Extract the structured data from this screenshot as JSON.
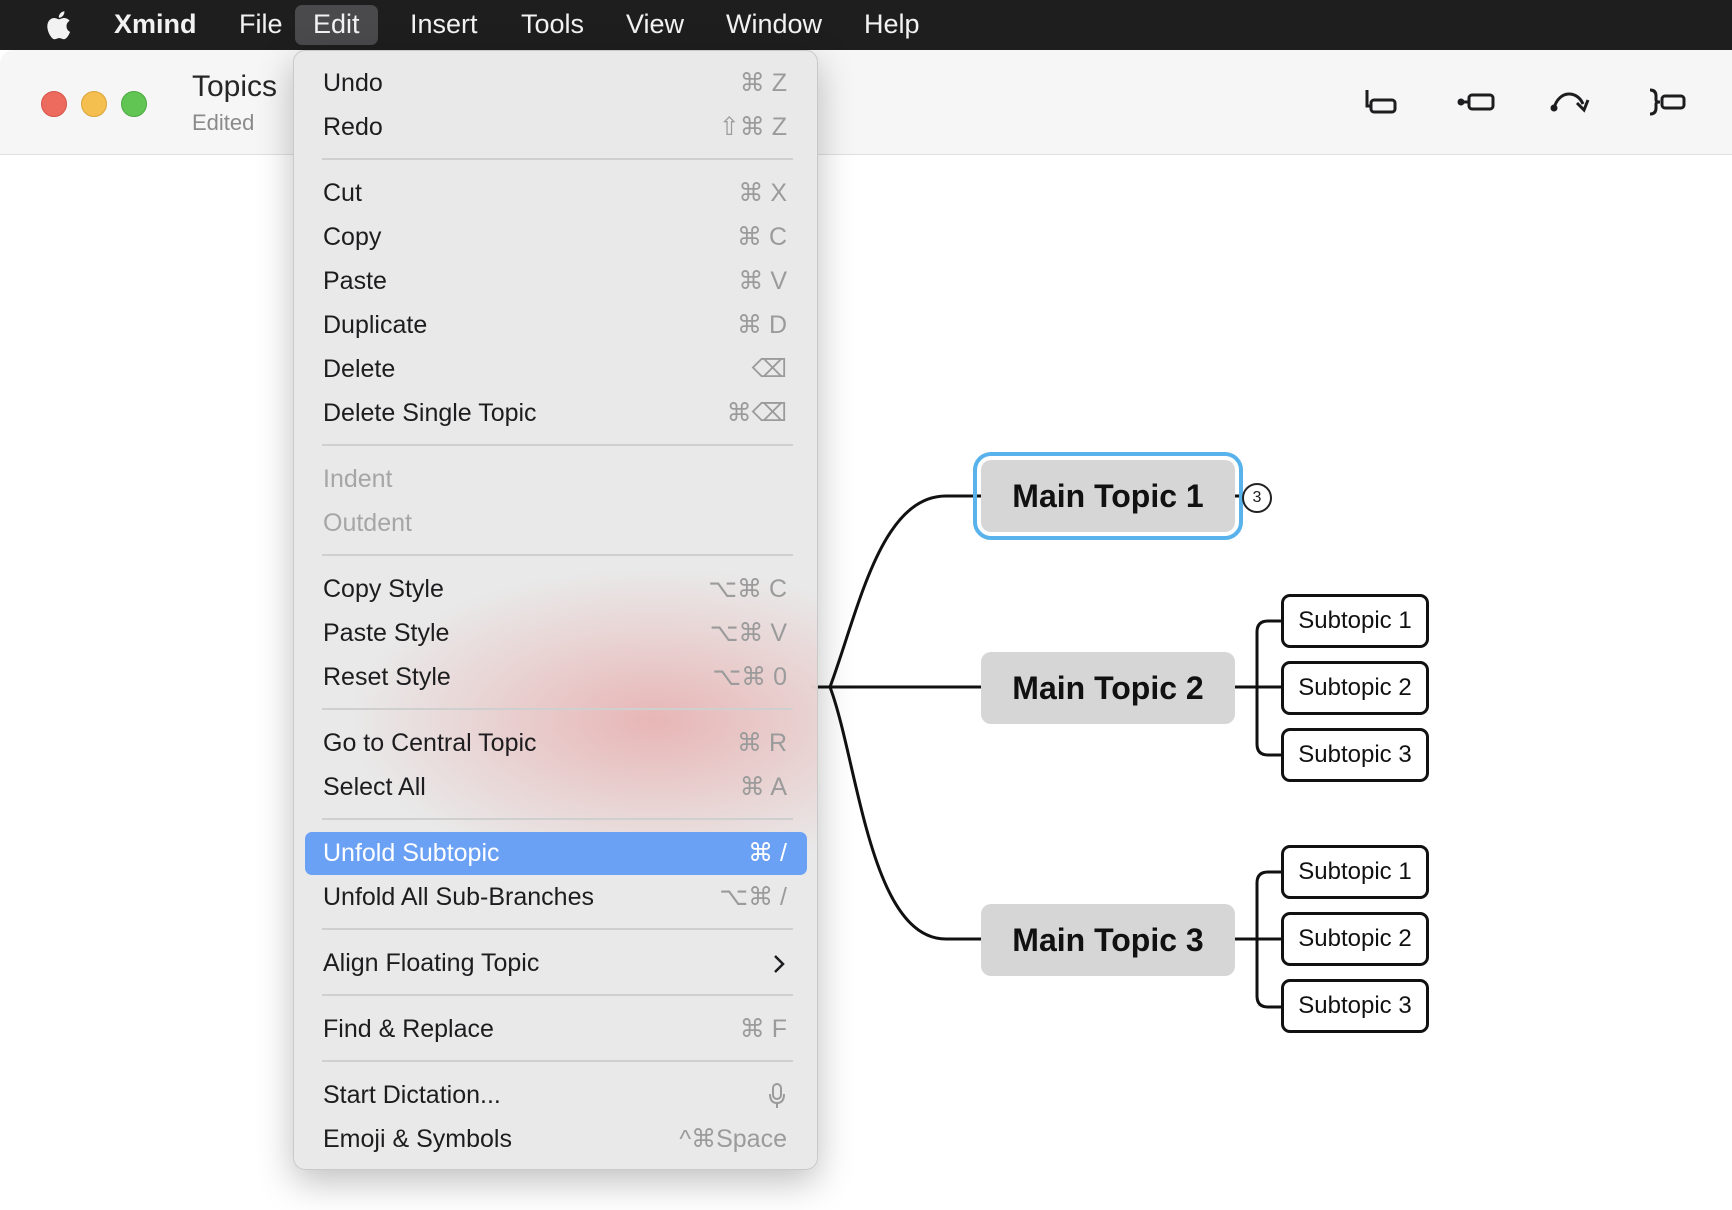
{
  "menubar": {
    "app_name": "Xmind",
    "items": [
      "File",
      "Edit",
      "Insert",
      "Tools",
      "View",
      "Window",
      "Help"
    ],
    "active_item": "Edit"
  },
  "window": {
    "title": "Topics",
    "subtitle": "Edited",
    "toolbar_icons": [
      "topic-icon",
      "subtopic-icon",
      "relationship-icon",
      "summary-icon"
    ]
  },
  "edit_menu": {
    "items": [
      {
        "label": "Undo",
        "shortcut": "⌘ Z"
      },
      {
        "label": "Redo",
        "shortcut": "⇧⌘ Z"
      },
      {
        "label": "Cut",
        "shortcut": "⌘ X"
      },
      {
        "label": "Copy",
        "shortcut": "⌘ C"
      },
      {
        "label": "Paste",
        "shortcut": "⌘ V"
      },
      {
        "label": "Duplicate",
        "shortcut": "⌘ D"
      },
      {
        "label": "Delete",
        "shortcut": "⌫"
      },
      {
        "label": "Delete Single Topic",
        "shortcut": "⌘⌫"
      },
      {
        "label": "Indent",
        "shortcut": "",
        "disabled": true
      },
      {
        "label": "Outdent",
        "shortcut": "",
        "disabled": true
      },
      {
        "label": "Copy Style",
        "shortcut": "⌥⌘ C"
      },
      {
        "label": "Paste Style",
        "shortcut": "⌥⌘ V"
      },
      {
        "label": "Reset Style",
        "shortcut": "⌥⌘ 0"
      },
      {
        "label": "Go to Central Topic",
        "shortcut": "⌘ R"
      },
      {
        "label": "Select All",
        "shortcut": "⌘ A"
      },
      {
        "label": "Unfold Subtopic",
        "shortcut": "⌘ /",
        "highlighted": true
      },
      {
        "label": "Unfold All Sub-Branches",
        "shortcut": "⌥⌘ /"
      },
      {
        "label": "Align Floating Topic",
        "shortcut": "",
        "submenu": true
      },
      {
        "label": "Find & Replace",
        "shortcut": "⌘ F"
      },
      {
        "label": "Start Dictation...",
        "shortcut": "",
        "icon": "microphone-icon"
      },
      {
        "label": "Emoji & Symbols",
        "shortcut": "^⌘Space"
      }
    ]
  },
  "mindmap": {
    "main_topics": [
      {
        "label": "Main Topic 1",
        "selected": true,
        "collapsed_count": "3",
        "subtopics": []
      },
      {
        "label": "Main Topic 2",
        "selected": false,
        "subtopics": [
          "Subtopic 1",
          "Subtopic 2",
          "Subtopic 3"
        ]
      },
      {
        "label": "Main Topic 3",
        "selected": false,
        "subtopics": [
          "Subtopic 1",
          "Subtopic 2",
          "Subtopic 3"
        ]
      }
    ]
  },
  "colors": {
    "menubar_bg": "#1e1e1f",
    "menu_highlight": "#6aa1f5",
    "selection_outline": "#58b3ec",
    "main_topic_fill": "#d6d6d6"
  }
}
